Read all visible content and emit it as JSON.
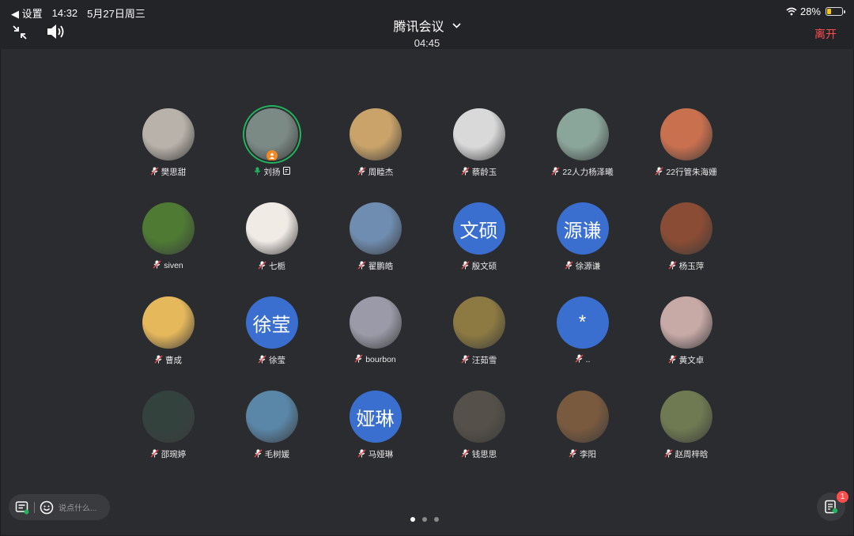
{
  "status_bar": {
    "back_label": "◀ 设置",
    "time": "14:32",
    "date": "5月27日周三",
    "battery_percent": "28%",
    "battery_level": 0.28
  },
  "header": {
    "title": "腾讯会议",
    "timer": "04:45",
    "leave_label": "离开"
  },
  "participants": [
    {
      "name": "樊思甜",
      "avatar": "photo",
      "color": "#b9b2aa"
    },
    {
      "name": "刘扬",
      "avatar": "photo",
      "color": "#7c8a86",
      "active": true,
      "host": true
    },
    {
      "name": "周睦杰",
      "avatar": "photo",
      "color": "#c9a36a"
    },
    {
      "name": "蔡龄玉",
      "avatar": "photo",
      "color": "#d9d9d9"
    },
    {
      "name": "22人力杨泽曦",
      "avatar": "photo",
      "color": "#8aa59a"
    },
    {
      "name": "22行管朱海姗",
      "avatar": "photo",
      "color": "#c9704f"
    },
    {
      "name": "siven",
      "avatar": "photo",
      "color": "#4e7a34"
    },
    {
      "name": "七栀",
      "avatar": "photo",
      "color": "#f1ebe6"
    },
    {
      "name": "翟鹏皓",
      "avatar": "photo",
      "color": "#6f8db0"
    },
    {
      "name": "殷文硕",
      "avatar": "text",
      "initials": "文硕"
    },
    {
      "name": "徐源谦",
      "avatar": "text",
      "initials": "源谦"
    },
    {
      "name": "杨玉萍",
      "avatar": "photo",
      "color": "#8a4c34"
    },
    {
      "name": "曹成",
      "avatar": "photo",
      "color": "#e6b85c"
    },
    {
      "name": "徐莹",
      "avatar": "text",
      "initials": "徐莹"
    },
    {
      "name": "bourbon",
      "avatar": "photo",
      "color": "#9a9aa8"
    },
    {
      "name": "汪茹雪",
      "avatar": "photo",
      "color": "#8c7a42"
    },
    {
      "name": "..",
      "avatar": "text",
      "initials": "*"
    },
    {
      "name": "黄文卓",
      "avatar": "photo",
      "color": "#c7a9a6"
    },
    {
      "name": "邵琬婷",
      "avatar": "photo",
      "color": "#34423e"
    },
    {
      "name": "毛树媛",
      "avatar": "photo",
      "color": "#5a86a8"
    },
    {
      "name": "马娅琳",
      "avatar": "text",
      "initials": "娅琳"
    },
    {
      "name": "钱思思",
      "avatar": "photo",
      "color": "#555049"
    },
    {
      "name": "李阳",
      "avatar": "photo",
      "color": "#7a5a3f"
    },
    {
      "name": "赵周梓晗",
      "avatar": "photo",
      "color": "#6f7a52"
    }
  ],
  "chat": {
    "placeholder": "说点什么..."
  },
  "pagination": {
    "total": 3,
    "current": 1
  },
  "notes_badge": "1"
}
